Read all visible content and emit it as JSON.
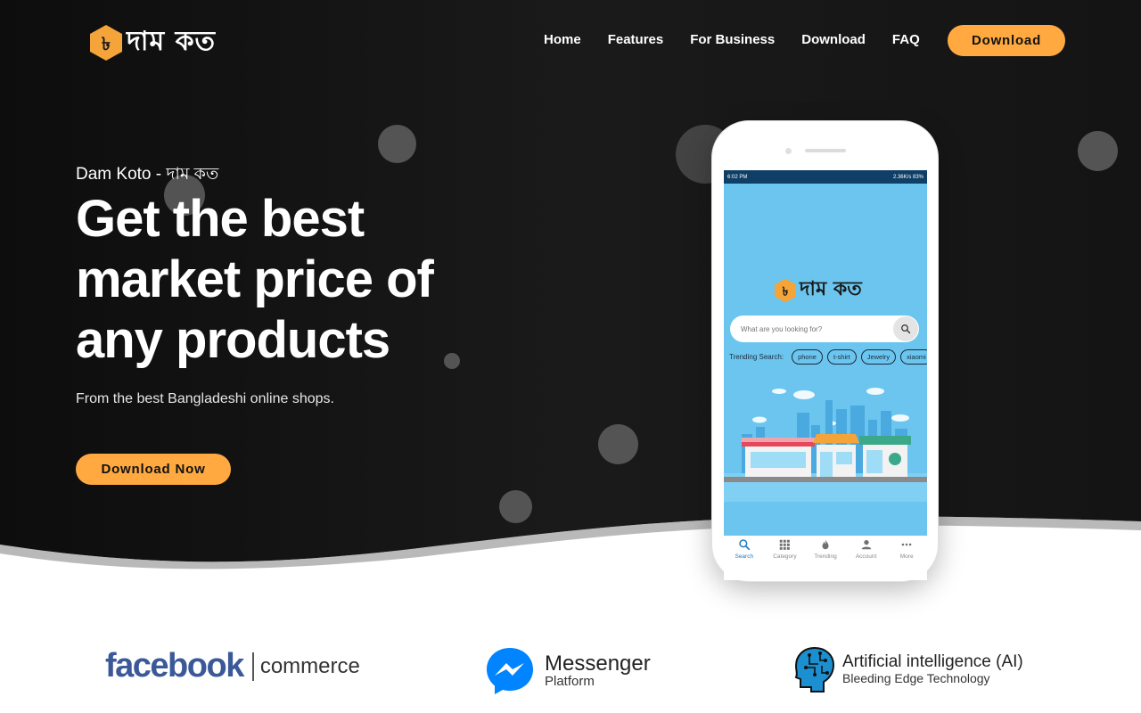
{
  "brand": {
    "logo_symbol": "৳",
    "logo_text": "দাম কত",
    "accent_color": "#ffa940",
    "hero_bg_color": "#111111"
  },
  "nav": {
    "links": [
      {
        "label": "Home"
      },
      {
        "label": "Features"
      },
      {
        "label": "For Business"
      },
      {
        "label": "Download"
      },
      {
        "label": "FAQ"
      }
    ],
    "cta_label": "Download"
  },
  "hero": {
    "eyebrow": "Dam Koto - দাম কত",
    "title_lines": [
      "Get the best",
      "market price of",
      "any products"
    ],
    "subtitle": "From the best Bangladeshi online shops.",
    "cta_label": "Download Now"
  },
  "phone": {
    "status_left": "6:02 PM",
    "status_right": "2.36K/s 83%",
    "app_logo_text": "দাম কত",
    "search_placeholder": "What are you looking for?",
    "trending_label": "Trending Search:",
    "trending_chips": [
      "phone",
      "t-shirt",
      "Jewelry",
      "xiaomi"
    ],
    "tabs": [
      {
        "label": "Search",
        "icon": "search-icon",
        "active": true
      },
      {
        "label": "Category",
        "icon": "grid-icon",
        "active": false
      },
      {
        "label": "Trending",
        "icon": "flame-icon",
        "active": false
      },
      {
        "label": "Account",
        "icon": "person-icon",
        "active": false
      },
      {
        "label": "More",
        "icon": "more-dots-icon",
        "active": false
      }
    ]
  },
  "partners": {
    "facebook": {
      "word": "facebook",
      "suffix": "commerce",
      "color": "#3b5998"
    },
    "messenger": {
      "title": "Messenger",
      "subtitle": "Platform",
      "color": "#0084ff"
    },
    "ai": {
      "title": "Artificial intelligence (AI)",
      "subtitle": "Bleeding Edge Technology",
      "color": "#1b8fcf"
    }
  }
}
